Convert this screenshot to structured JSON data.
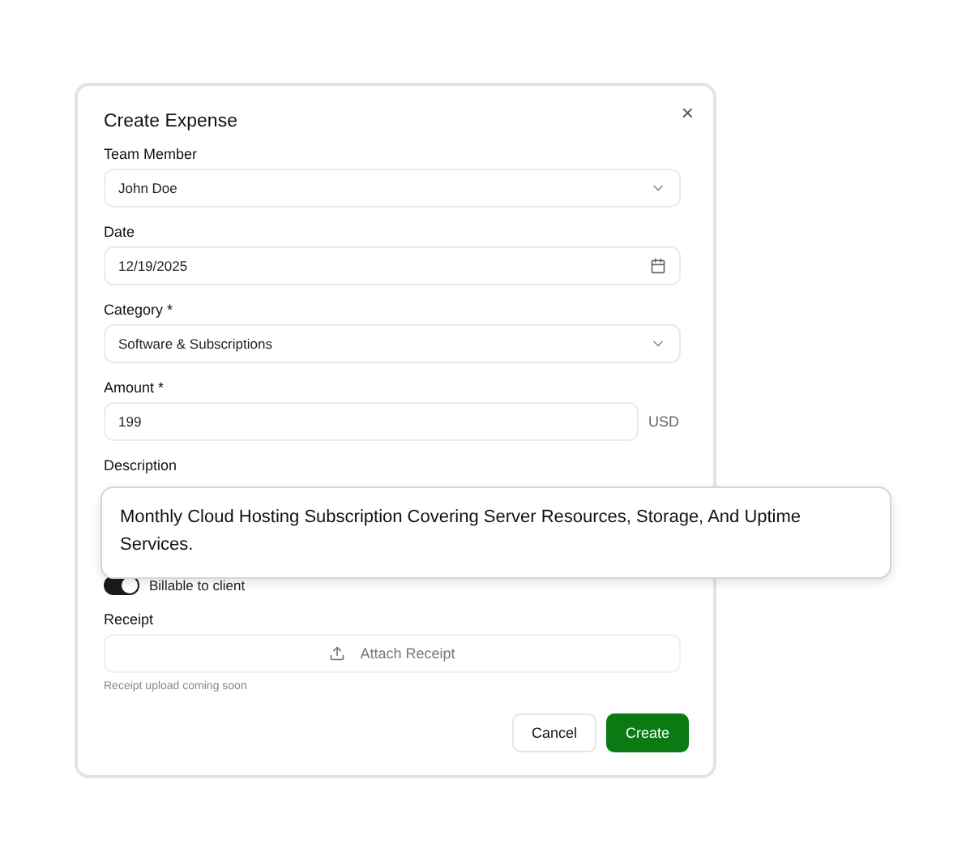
{
  "dialog": {
    "title": "Create Expense",
    "close": "×"
  },
  "fields": [
    {
      "kind": "select",
      "label": "Team Member",
      "value": "John Doe"
    },
    {
      "kind": "date",
      "label": "Date",
      "value": "12/19/2025"
    },
    {
      "kind": "select",
      "label": "Category *",
      "value": "Software & Subscriptions"
    },
    {
      "kind": "amount",
      "label": "Amount *",
      "value": "199",
      "unit": "USD"
    },
    {
      "kind": "hidden",
      "label": "Description"
    }
  ],
  "billable": {
    "label": "Billable to client",
    "on": true
  },
  "receipt": {
    "label": "Receipt",
    "button": "Attach Receipt",
    "hint": "Receipt upload coming soon"
  },
  "buttons": [
    {
      "kind": "secondary",
      "label": "Cancel"
    },
    {
      "kind": "primary",
      "label": "Create"
    }
  ],
  "tooltip": {
    "text": "Monthly Cloud Hosting Subscription Covering Server Resources, Storage, And Uptime Services."
  }
}
